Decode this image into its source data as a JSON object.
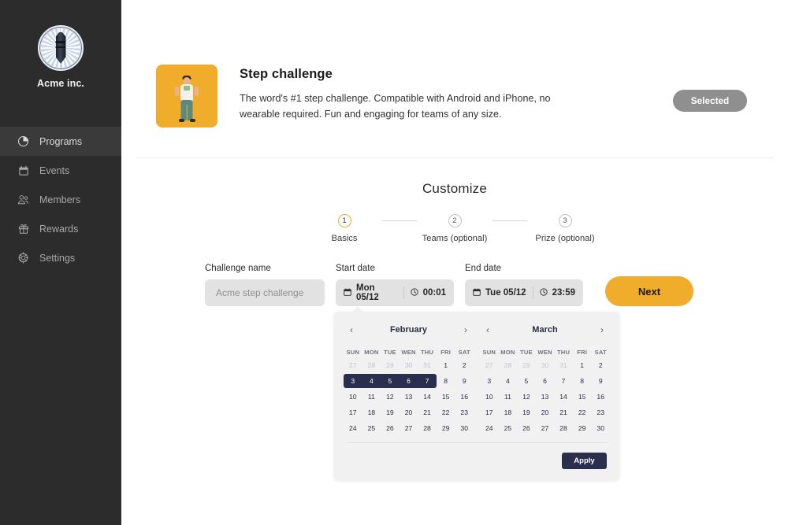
{
  "sidebar": {
    "brand_name": "Acme inc.",
    "logo_icon": "rocket-badge-logo",
    "items": [
      {
        "label": "Programs",
        "icon": "pie-chart-icon",
        "active": true
      },
      {
        "label": "Events",
        "icon": "calendar-icon",
        "active": false
      },
      {
        "label": "Members",
        "icon": "members-icon",
        "active": false
      },
      {
        "label": "Rewards",
        "icon": "gift-icon",
        "active": false
      },
      {
        "label": "Settings",
        "icon": "gear-icon",
        "active": false
      }
    ]
  },
  "hero": {
    "thumb_icon": "person-with-phone-illustration",
    "thumb_bg": "#f0ad2b",
    "title": "Step challenge",
    "description": "The word's #1 step challenge. Compatible with Android and iPhone, no wearable required. Fun and engaging for teams of any size.",
    "selected_label": "Selected"
  },
  "customize": {
    "title": "Customize",
    "steps": [
      {
        "number": "1",
        "label": "Basics",
        "active": true
      },
      {
        "number": "2",
        "label": "Teams (optional)",
        "active": false
      },
      {
        "number": "3",
        "label": "Prize (optional)",
        "active": false
      }
    ]
  },
  "form": {
    "challenge_name": {
      "label": "Challenge name",
      "value": "",
      "placeholder": "Acme step challenge"
    },
    "start_date": {
      "label": "Start date",
      "date": "Mon 05/12",
      "time": "00:01",
      "date_icon": "calendar-icon",
      "time_icon": "clock-icon"
    },
    "end_date": {
      "label": "End date",
      "date": "Tue 05/12",
      "time": "23:59",
      "date_icon": "calendar-icon",
      "time_icon": "clock-icon"
    },
    "next_label": "Next",
    "next_color": "#f0ad2b"
  },
  "calendar": {
    "prev_icon": "chevron-left-icon",
    "next_icon": "chevron-right-icon",
    "dow": [
      "SUN",
      "MON",
      "TUE",
      "WEN",
      "THU",
      "FRI",
      "SAT"
    ],
    "apply_label": "Apply",
    "selection_color": "#2b2f4e",
    "months": [
      {
        "name": "February",
        "weeks": [
          [
            {
              "d": "27",
              "muted": true
            },
            {
              "d": "28",
              "muted": true
            },
            {
              "d": "29",
              "muted": true
            },
            {
              "d": "30",
              "muted": true
            },
            {
              "d": "31",
              "muted": true
            },
            {
              "d": "1"
            },
            {
              "d": "2"
            }
          ],
          [
            {
              "d": "3",
              "sel": true
            },
            {
              "d": "4",
              "sel": true
            },
            {
              "d": "5",
              "sel": true
            },
            {
              "d": "6",
              "sel": true
            },
            {
              "d": "7",
              "sel": true
            },
            {
              "d": "8"
            },
            {
              "d": "9"
            }
          ],
          [
            {
              "d": "10"
            },
            {
              "d": "11"
            },
            {
              "d": "12"
            },
            {
              "d": "13"
            },
            {
              "d": "14"
            },
            {
              "d": "15"
            },
            {
              "d": "16"
            }
          ],
          [
            {
              "d": "17"
            },
            {
              "d": "18"
            },
            {
              "d": "19"
            },
            {
              "d": "20"
            },
            {
              "d": "21"
            },
            {
              "d": "22"
            },
            {
              "d": "23"
            }
          ],
          [
            {
              "d": "24"
            },
            {
              "d": "25"
            },
            {
              "d": "26"
            },
            {
              "d": "27"
            },
            {
              "d": "28"
            },
            {
              "d": "29"
            },
            {
              "d": "30"
            }
          ]
        ]
      },
      {
        "name": "March",
        "weeks": [
          [
            {
              "d": "27",
              "muted": true
            },
            {
              "d": "28",
              "muted": true
            },
            {
              "d": "29",
              "muted": true
            },
            {
              "d": "30",
              "muted": true
            },
            {
              "d": "31",
              "muted": true
            },
            {
              "d": "1"
            },
            {
              "d": "2"
            }
          ],
          [
            {
              "d": "3"
            },
            {
              "d": "4"
            },
            {
              "d": "5"
            },
            {
              "d": "6"
            },
            {
              "d": "7"
            },
            {
              "d": "8"
            },
            {
              "d": "9"
            }
          ],
          [
            {
              "d": "10"
            },
            {
              "d": "11"
            },
            {
              "d": "12"
            },
            {
              "d": "13"
            },
            {
              "d": "14"
            },
            {
              "d": "15"
            },
            {
              "d": "16"
            }
          ],
          [
            {
              "d": "17"
            },
            {
              "d": "18"
            },
            {
              "d": "19"
            },
            {
              "d": "20"
            },
            {
              "d": "21"
            },
            {
              "d": "22"
            },
            {
              "d": "23"
            }
          ],
          [
            {
              "d": "24"
            },
            {
              "d": "25"
            },
            {
              "d": "26"
            },
            {
              "d": "27"
            },
            {
              "d": "28"
            },
            {
              "d": "29"
            },
            {
              "d": "30"
            }
          ]
        ]
      }
    ]
  }
}
